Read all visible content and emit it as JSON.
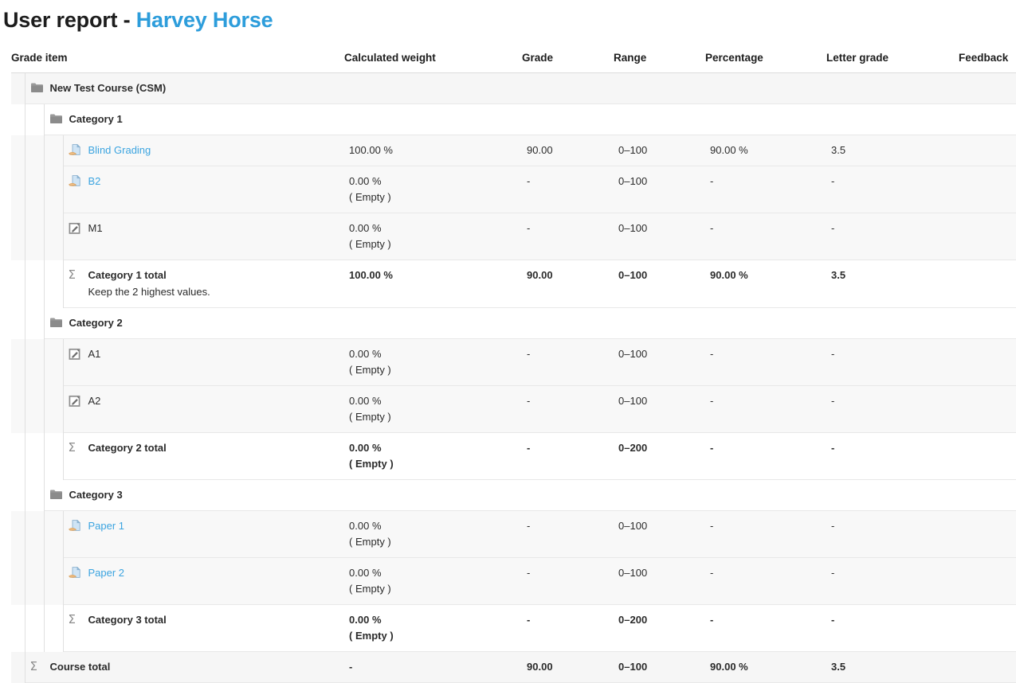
{
  "header": {
    "title_prefix": "User report - ",
    "user_name": "Harvey Horse",
    "link_color": "#3ba4e0"
  },
  "table": {
    "columns": [
      "Grade item",
      "Calculated weight",
      "Grade",
      "Range",
      "Percentage",
      "Letter grade",
      "Feedback"
    ],
    "rows": [
      {
        "level": "course",
        "icon": "folder-icon",
        "name": "New Test Course (CSM)",
        "weight": "",
        "weight_note": "",
        "grade": "",
        "range": "",
        "percentage": "",
        "letter": "",
        "feedback": ""
      },
      {
        "level": "category",
        "icon": "folder-icon",
        "name": "Category 1",
        "weight": "",
        "weight_note": "",
        "grade": "",
        "range": "",
        "percentage": "",
        "letter": "",
        "feedback": ""
      },
      {
        "level": "item",
        "icon": "assignment-icon",
        "name": "Blind Grading",
        "is_link": true,
        "weight": "100.00 %",
        "weight_note": "",
        "grade": "90.00",
        "range": "0–100",
        "percentage": "90.00 %",
        "letter": "3.5",
        "feedback": ""
      },
      {
        "level": "item",
        "icon": "assignment-icon",
        "name": "B2",
        "is_link": true,
        "weight": "0.00 %",
        "weight_note": "( Empty )",
        "grade": "-",
        "range": "0–100",
        "percentage": "-",
        "letter": "-",
        "feedback": ""
      },
      {
        "level": "item",
        "icon": "manual-grade-icon",
        "name": "M1",
        "is_link": false,
        "weight": "0.00 %",
        "weight_note": "( Empty )",
        "grade": "-",
        "range": "0–100",
        "percentage": "-",
        "letter": "-",
        "feedback": ""
      },
      {
        "level": "total",
        "icon": "sigma-icon",
        "name": "Category 1 total",
        "subtitle": "Keep the 2 highest values.",
        "weight": "100.00 %",
        "weight_note": "",
        "grade": "90.00",
        "range": "0–100",
        "percentage": "90.00 %",
        "letter": "3.5",
        "feedback": ""
      },
      {
        "level": "category",
        "icon": "folder-icon",
        "name": "Category 2",
        "weight": "",
        "weight_note": "",
        "grade": "",
        "range": "",
        "percentage": "",
        "letter": "",
        "feedback": ""
      },
      {
        "level": "item",
        "icon": "manual-grade-icon",
        "name": "A1",
        "is_link": false,
        "weight": "0.00 %",
        "weight_note": "( Empty )",
        "grade": "-",
        "range": "0–100",
        "percentage": "-",
        "letter": "-",
        "feedback": ""
      },
      {
        "level": "item",
        "icon": "manual-grade-icon",
        "name": "A2",
        "is_link": false,
        "weight": "0.00 %",
        "weight_note": "( Empty )",
        "grade": "-",
        "range": "0–100",
        "percentage": "-",
        "letter": "-",
        "feedback": ""
      },
      {
        "level": "total",
        "icon": "sigma-icon",
        "name": "Category 2 total",
        "subtitle": "",
        "weight": "0.00 %",
        "weight_note": "( Empty )",
        "grade": "-",
        "range": "0–200",
        "percentage": "-",
        "letter": "-",
        "feedback": ""
      },
      {
        "level": "category",
        "icon": "folder-icon",
        "name": "Category 3",
        "weight": "",
        "weight_note": "",
        "grade": "",
        "range": "",
        "percentage": "",
        "letter": "",
        "feedback": ""
      },
      {
        "level": "item",
        "icon": "assignment-icon",
        "name": "Paper 1",
        "is_link": true,
        "weight": "0.00 %",
        "weight_note": "( Empty )",
        "grade": "-",
        "range": "0–100",
        "percentage": "-",
        "letter": "-",
        "feedback": ""
      },
      {
        "level": "item",
        "icon": "assignment-icon",
        "name": "Paper 2",
        "is_link": true,
        "weight": "0.00 %",
        "weight_note": "( Empty )",
        "grade": "-",
        "range": "0–100",
        "percentage": "-",
        "letter": "-",
        "feedback": ""
      },
      {
        "level": "total",
        "icon": "sigma-icon",
        "name": "Category 3 total",
        "subtitle": "",
        "weight": "0.00 %",
        "weight_note": "( Empty )",
        "grade": "-",
        "range": "0–200",
        "percentage": "-",
        "letter": "-",
        "feedback": ""
      },
      {
        "level": "coursetotal",
        "icon": "sigma-icon",
        "name": "Course total",
        "subtitle": "",
        "weight": "-",
        "weight_note": "",
        "grade": "90.00",
        "range": "0–100",
        "percentage": "90.00 %",
        "letter": "3.5",
        "feedback": ""
      }
    ]
  }
}
